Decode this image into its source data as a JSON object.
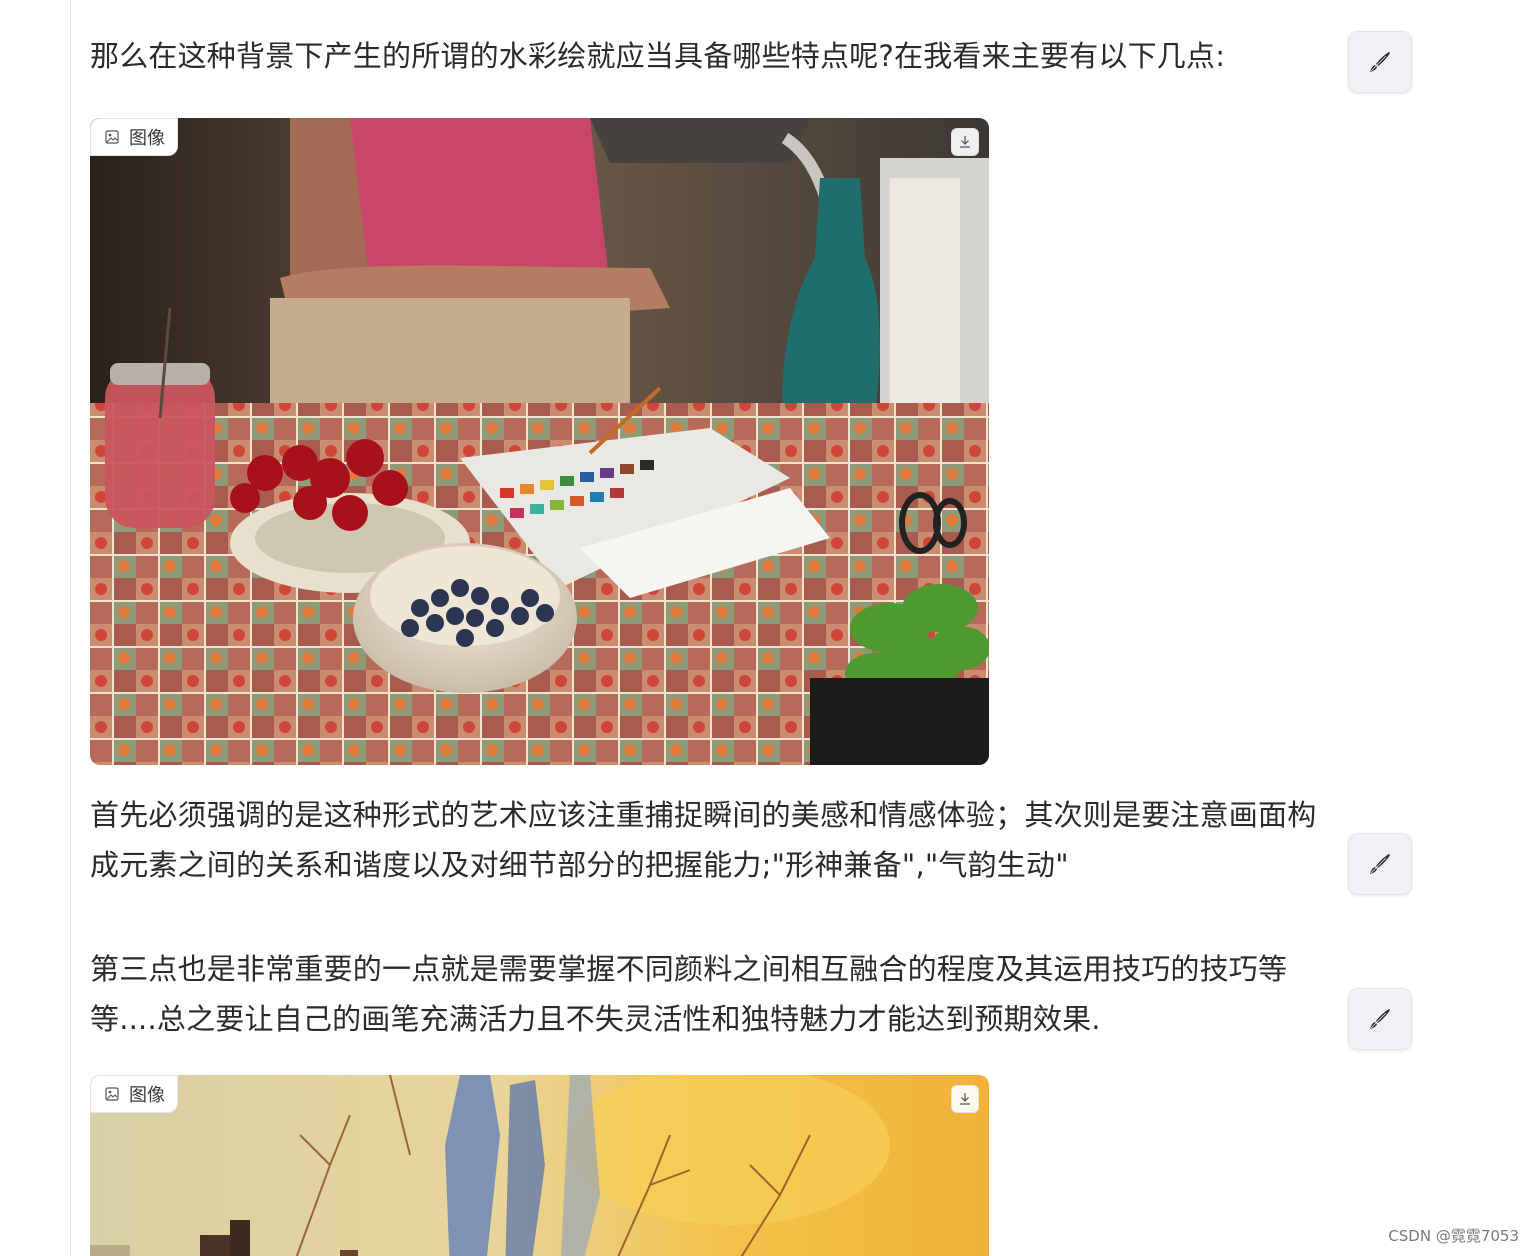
{
  "paragraphs": {
    "p1": "那么在这种背景下产生的所谓的水彩绘就应当具备哪些特点呢?在我看来主要有以下几点:",
    "p2": "首先必须强调的是这种形式的艺术应该注重捕捉瞬间的美感和情感体验；其次则是要注意画面构成元素之间的关系和谐度以及对细节部分的把握能力;\"形神兼备\",\"气韵生动\"",
    "p3": "第三点也是非常重要的一点就是需要掌握不同颜料之间相互融合的程度及其运用技巧的技巧等等....总之要让自己的画笔充满活力且不失灵活性和独特魅力才能达到预期效果."
  },
  "images": {
    "image1": {
      "tag_label": "图像",
      "tag_icon": "image-icon",
      "download_icon": "download-icon"
    },
    "image2": {
      "tag_label": "图像",
      "tag_icon": "image-icon",
      "download_icon": "download-icon"
    }
  },
  "edit_button_icon": "brush-icon",
  "watermark": "CSDN @霓霓7053",
  "colors": {
    "text": "#2b2b2b",
    "button_bg": "#f0f1f4",
    "rule": "#e6e6ea"
  }
}
